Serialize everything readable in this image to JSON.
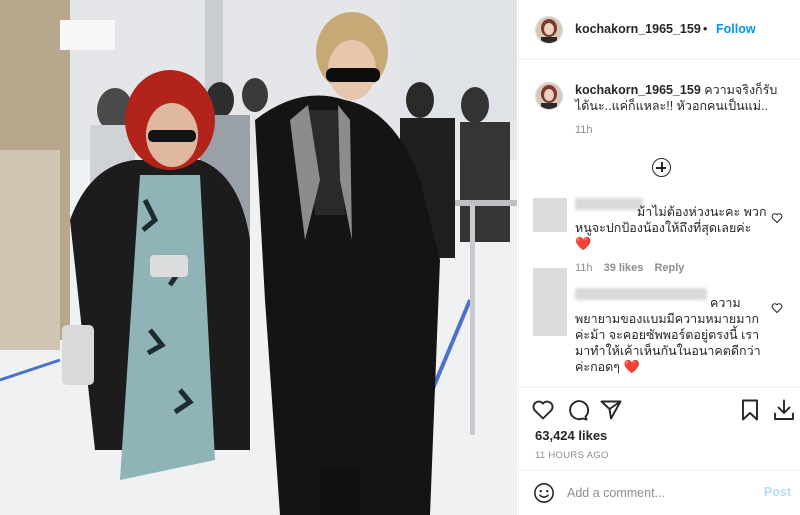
{
  "header": {
    "username": "kochakorn_1965_159",
    "separator": "•",
    "follow_label": "Follow"
  },
  "caption": {
    "username": "kochakorn_1965_159",
    "text": "ความจริงก็รับได้นะ..แค่ก็แหละ!! หัวอกคนเป็นแม่..",
    "time": "11h"
  },
  "comments": [
    {
      "text_visible": "ม้าไม่ต้องห่วงนะคะ พวกหนูจะปกป้องน้องให้ถึงที่สุดเลยค่ะ",
      "emoji": "❤️",
      "time": "11h",
      "likes": "39 likes",
      "reply_label": "Reply"
    },
    {
      "text_visible": "ความพยายามของแบมมีความหมายมากค่ะม้า จะคอยซัพพอร์ตอยู่ตรงนี้ เรามาทำให้เค้าเห็นกันในอนาคตดีกว่าค่ะกอดๆ",
      "emoji": "❤️"
    }
  ],
  "actions": {
    "likes": "63,424 likes",
    "ago": "11 HOURS AGO",
    "icons": [
      "heart-icon",
      "comment-icon",
      "share-icon",
      "bookmark-icon",
      "download-icon"
    ]
  },
  "add_comment": {
    "placeholder": "Add a comment...",
    "post_label": "Post"
  },
  "colors": {
    "link_blue": "#0095f6",
    "post_disabled": "#b2dffc",
    "heart_red": "#ed4956",
    "muted": "#8e8e8e"
  }
}
